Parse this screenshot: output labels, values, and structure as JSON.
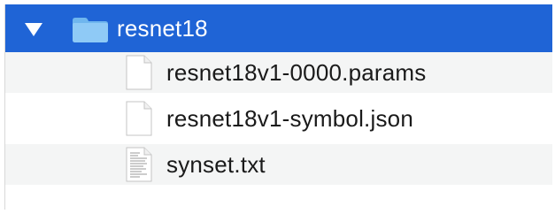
{
  "folder": {
    "name": "resnet18",
    "icon": "folder-icon",
    "expanded": true,
    "accent_color": "#1f64d6"
  },
  "files": [
    {
      "name": "resnet18v1-0000.params",
      "icon": "blank-document-icon"
    },
    {
      "name": "resnet18v1-symbol.json",
      "icon": "blank-document-icon"
    },
    {
      "name": "synset.txt",
      "icon": "text-document-icon"
    }
  ]
}
